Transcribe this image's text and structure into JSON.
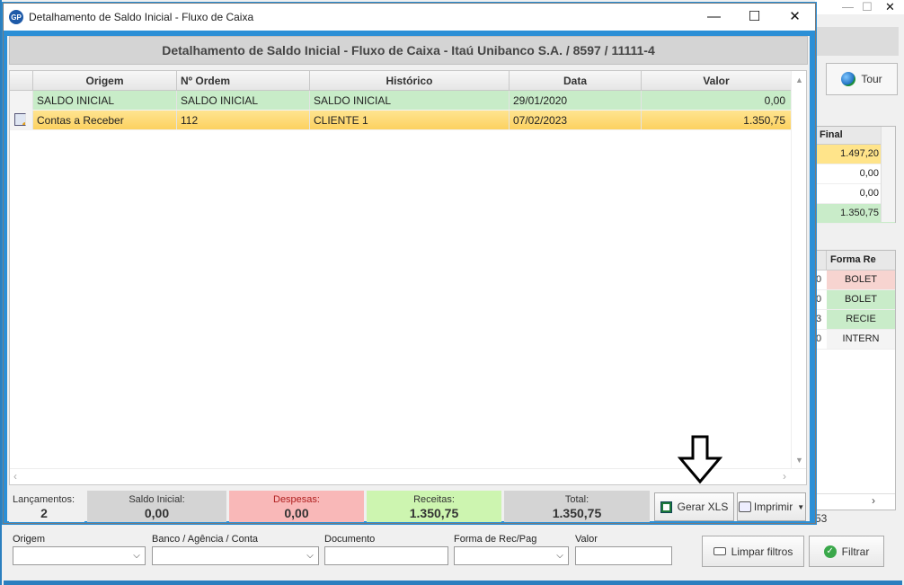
{
  "modal": {
    "title": "Detalhamento de Saldo Inicial - Fluxo de Caixa",
    "app_icon": "GP",
    "header": "Detalhamento de Saldo Inicial - Fluxo de Caixa - Itaú Unibanco S.A. / 8597 / 11111-4"
  },
  "grid": {
    "columns": [
      "Origem",
      "Nº Ordem",
      "Histórico",
      "Data",
      "Valor"
    ],
    "rows": [
      {
        "origem": "SALDO INICIAL",
        "ordem": "SALDO INICIAL",
        "historico": "SALDO INICIAL",
        "data": "29/01/2020",
        "valor": "0,00",
        "color": "#c8ecc8"
      },
      {
        "origem": "Contas a Receber",
        "ordem": "112",
        "historico": "CLIENTE 1",
        "data": "07/02/2023",
        "valor": "1.350,75",
        "color": "#fcd160"
      }
    ]
  },
  "summary": {
    "lancamentos_label": "Lançamentos:",
    "lancamentos_value": "2",
    "saldo_label": "Saldo Inicial:",
    "saldo_value": "0,00",
    "despesas_label": "Despesas:",
    "despesas_value": "0,00",
    "receitas_label": "Receitas:",
    "receitas_value": "1.350,75",
    "total_label": "Total:",
    "total_value": "1.350,75"
  },
  "buttons": {
    "gerar_xls": "Gerar XLS",
    "imprimir": "Imprimir"
  },
  "background": {
    "tour": "Tour",
    "grid1_header": "Final",
    "grid1_values": [
      "1.497,20",
      "0,00",
      "0,00",
      "1.350,75"
    ],
    "grid2_header": "Forma Re",
    "grid2_rows": [
      {
        "a": "0",
        "b": "BOLET"
      },
      {
        "a": "0",
        "b": "BOLET"
      },
      {
        "a": "3",
        "b": "RECIE"
      },
      {
        "a": "0",
        "b": "INTERN"
      }
    ],
    "count": "53"
  },
  "filters": {
    "origem_label": "Origem",
    "banco_label": "Banco / Agência / Conta",
    "documento_label": "Documento",
    "forma_label": "Forma de Rec/Pag",
    "valor_label": "Valor",
    "limpar": "Limpar filtros",
    "filtrar": "Filtrar"
  }
}
